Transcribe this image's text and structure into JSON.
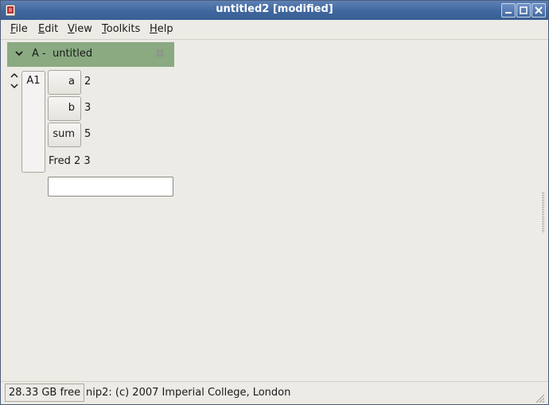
{
  "window": {
    "title": "untitled2 [modified]",
    "controls": {
      "minimize": "minimize-icon",
      "maximize": "maximize-icon",
      "close": "close-icon"
    }
  },
  "menubar": {
    "items": [
      {
        "label": "File",
        "mnemonic": "F",
        "rest": "ile"
      },
      {
        "label": "Edit",
        "mnemonic": "E",
        "rest": "dit"
      },
      {
        "label": "View",
        "mnemonic": "V",
        "rest": "iew"
      },
      {
        "label": "Toolkits",
        "mnemonic": "T",
        "rest": "oolkits"
      },
      {
        "label": "Help",
        "mnemonic": "H",
        "rest": "elp"
      }
    ]
  },
  "workspace": {
    "title": "A -  untitled",
    "header_color": "#8aaa82",
    "column": {
      "label": "A1",
      "rows": [
        {
          "name": "a",
          "value": "2"
        },
        {
          "name": "b",
          "value": "3"
        },
        {
          "name": "sum",
          "value": "5"
        }
      ],
      "result_text": "Fred 2 3",
      "entry_value": ""
    }
  },
  "status": {
    "free_space": "28.33 GB free",
    "message": "nip2: (c) 2007 Imperial College, London"
  }
}
